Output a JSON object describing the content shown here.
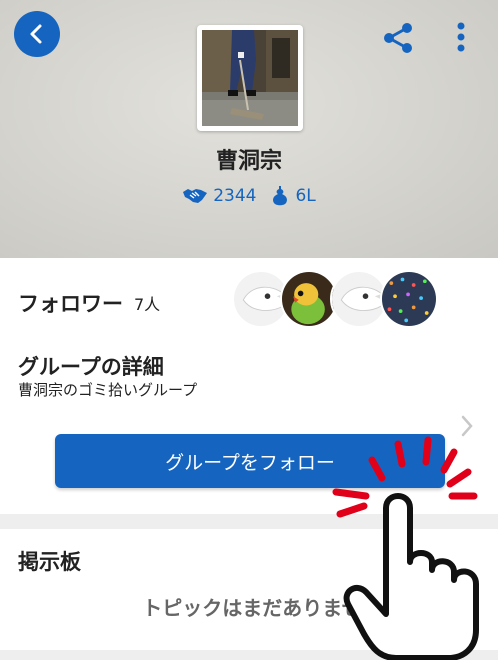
{
  "header": {
    "group_name": "曹洞宗",
    "stats": [
      {
        "icon": "handshake-icon",
        "value": "2344"
      },
      {
        "icon": "gourd-icon",
        "value": "6L"
      }
    ]
  },
  "followers": {
    "label": "フォロワー",
    "count": "7人"
  },
  "details": {
    "title": "グループの詳細",
    "description": "曹洞宗のゴミ拾いグループ"
  },
  "follow_button_label": "グループをフォロー",
  "board": {
    "title": "掲示板",
    "empty_message": "トピックはまだありません"
  },
  "colors": {
    "accent": "#1565c0",
    "annotation": "#e0001a"
  }
}
